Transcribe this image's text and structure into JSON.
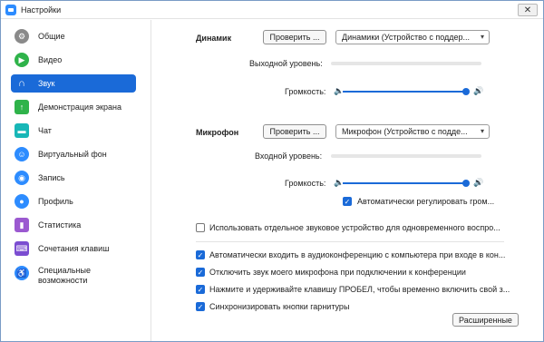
{
  "window": {
    "title": "Настройки",
    "close_glyph": "✕"
  },
  "sidebar": {
    "items": [
      {
        "label": "Общие",
        "icon": "gear-icon",
        "color": "#8a8a8a",
        "glyph": "⚙"
      },
      {
        "label": "Видео",
        "icon": "video-icon",
        "color": "#2fb34a",
        "glyph": "▶"
      },
      {
        "label": "Звук",
        "icon": "headphones-icon",
        "color": "#1a6ad8",
        "glyph": "∩",
        "active": true
      },
      {
        "label": "Демонстрация экрана",
        "icon": "share-screen-icon",
        "color": "#2fb34a",
        "glyph": "↑"
      },
      {
        "label": "Чат",
        "icon": "chat-icon",
        "color": "#18b7b7",
        "glyph": "▬"
      },
      {
        "label": "Виртуальный фон",
        "icon": "virtual-background-icon",
        "color": "#2d8cff",
        "glyph": "☺"
      },
      {
        "label": "Запись",
        "icon": "record-icon",
        "color": "#2d8cff",
        "glyph": "◉"
      },
      {
        "label": "Профиль",
        "icon": "profile-icon",
        "color": "#2d8cff",
        "glyph": "●"
      },
      {
        "label": "Статистика",
        "icon": "statistics-icon",
        "color": "#9b59d0",
        "glyph": "▮"
      },
      {
        "label": "Сочетания клавиш",
        "icon": "keyboard-icon",
        "color": "#7b4dd1",
        "glyph": "⌨"
      },
      {
        "label": "Специальные возможности",
        "icon": "accessibility-icon",
        "color": "#2d8cff",
        "glyph": "♿"
      }
    ]
  },
  "speaker": {
    "label": "Динамик",
    "test_button": "Проверить ...",
    "device": "Динамики (Устройство с поддер...",
    "output_level_label": "Выходной уровень:",
    "volume_label": "Громкость:",
    "volume": 0.95
  },
  "microphone": {
    "label": "Микрофон",
    "test_button": "Проверить ...",
    "device": "Микрофон (Устройство с подде...",
    "input_level_label": "Входной уровень:",
    "volume_label": "Громкость:",
    "volume": 0.95,
    "auto_adjust": "Автоматически регулировать гром..."
  },
  "options": {
    "separate_device": "Использовать отдельное звуковое устройство для одновременного воспро...",
    "auto_join_audio": "Автоматически входить в аудиоконференцию с компьютера при входе в кон...",
    "mute_on_join": "Отключить звук моего микрофона при подключении к конференции",
    "push_to_talk": "Нажмите и удерживайте клавишу ПРОБЕЛ, чтобы временно включить свой з...",
    "sync_headset": "Синхронизировать кнопки гарнитуры"
  },
  "advanced_button": "Расширенные",
  "icons": {
    "speaker_low": "🔈",
    "speaker_high": "🔊",
    "check": "✓",
    "chevron": "▾"
  },
  "colors": {
    "accent": "#1a6ad8"
  }
}
